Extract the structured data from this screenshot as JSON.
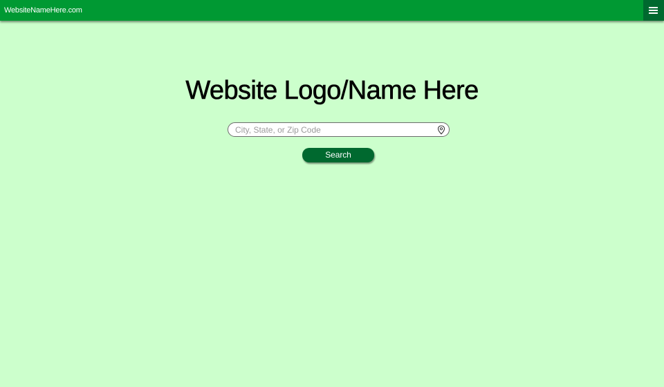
{
  "header": {
    "site_name": "WebsiteNameHere.com",
    "menu_icon": "hamburger-menu-icon"
  },
  "main": {
    "logo_text": "Website Logo/Name Here",
    "search": {
      "placeholder": "City, State, or Zip Code",
      "value": "",
      "icon": "location-pin-icon"
    },
    "search_button_label": "Search"
  },
  "colors": {
    "page_background": "#ccffcc",
    "topbar": "#009933",
    "menu_button": "#00692f",
    "search_button": "#00692f"
  }
}
